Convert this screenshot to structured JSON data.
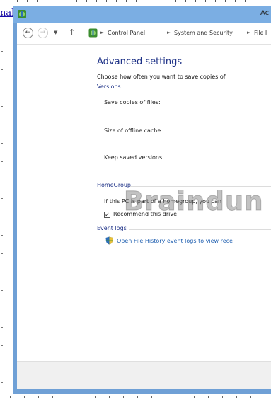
{
  "edge_link": "nal",
  "window": {
    "title": "Ac"
  },
  "address_bar": {
    "breadcrumbs": [
      "Control Panel",
      "System and Security",
      "File I"
    ]
  },
  "page": {
    "heading": "Advanced settings",
    "description": "Choose how often you want to save copies of",
    "versions": {
      "group_label": "Versions",
      "save_copies_label": "Save copies of files:",
      "cache_size_label": "Size of offline cache:",
      "keep_versions_label": "Keep saved versions:"
    },
    "homegroup": {
      "group_label": "HomeGroup",
      "info_text": "If this PC is part of a homegroup, you can",
      "recommend_checked": true,
      "recommend_label": "Recommend this drive"
    },
    "event_logs": {
      "group_label": "Event logs",
      "open_link": "Open File History event logs to view rece"
    }
  },
  "watermark": "Braindun",
  "icons": {
    "app": "control-panel-icon",
    "back": "back-arrow-icon",
    "forward": "forward-arrow-icon",
    "up": "up-arrow-icon",
    "shield": "shield-icon"
  },
  "colors": {
    "title_bar": "#7baee3",
    "heading": "#1e3287",
    "link": "#1f5fb0"
  }
}
